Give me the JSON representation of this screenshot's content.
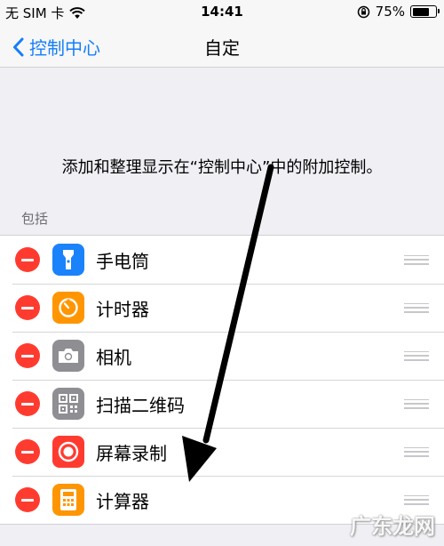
{
  "status_bar": {
    "carrier": "无 SIM 卡",
    "time": "14:41",
    "battery_percent": "75%",
    "battery_level": 0.75,
    "icons": [
      "wifi-icon",
      "rotation-lock-icon",
      "battery-icon"
    ]
  },
  "nav": {
    "back_label": "控制中心",
    "title": "自定"
  },
  "description": "添加和整理显示在“控制中心”中的附加控制。",
  "section_header": "包括",
  "items": [
    {
      "label": "手电筒",
      "icon": "flashlight-icon",
      "color": "#1a82fb"
    },
    {
      "label": "计时器",
      "icon": "timer-icon",
      "color": "#ff9500"
    },
    {
      "label": "相机",
      "icon": "camera-icon",
      "color": "#8e8e93"
    },
    {
      "label": "扫描二维码",
      "icon": "qr-code-icon",
      "color": "#8e8e93"
    },
    {
      "label": "屏幕录制",
      "icon": "screen-record-icon",
      "color": "#ff3b30"
    },
    {
      "label": "计算器",
      "icon": "calculator-icon",
      "color": "#ff9500"
    }
  ],
  "watermark": "广东龙网",
  "colors": {
    "accent": "#147efb",
    "remove": "#ff3b30",
    "background": "#efeff4"
  }
}
